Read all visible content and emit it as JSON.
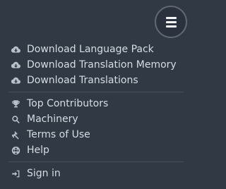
{
  "menu_button": {
    "icon": "hamburger-icon"
  },
  "menu": {
    "group1": [
      {
        "label": "Download Language Pack",
        "icon": "cloud-download-icon"
      },
      {
        "label": "Download Translation Memory",
        "icon": "cloud-download-icon"
      },
      {
        "label": "Download Translations",
        "icon": "cloud-download-icon"
      }
    ],
    "group2": [
      {
        "label": "Top Contributors",
        "icon": "trophy-icon"
      },
      {
        "label": "Machinery",
        "icon": "search-icon"
      },
      {
        "label": "Terms of Use",
        "icon": "gavel-icon"
      },
      {
        "label": "Help",
        "icon": "life-ring-icon"
      }
    ],
    "group3": [
      {
        "label": "Sign in",
        "icon": "sign-in-icon"
      }
    ]
  },
  "colors": {
    "background": "#313945",
    "text": "#d6dce2",
    "icon": "#b8c0c9",
    "divider": "#46505c"
  }
}
